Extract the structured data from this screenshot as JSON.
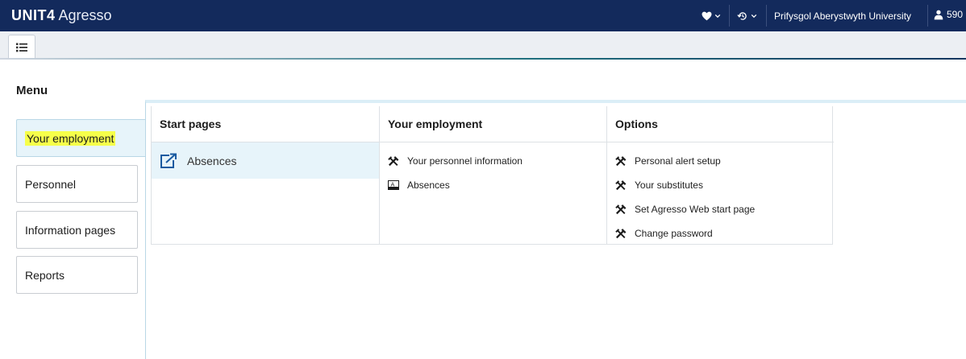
{
  "app": {
    "brand_bold": "UNIT4",
    "brand_light": "Agresso",
    "university": "Prifysgol Aberystwyth University",
    "user_id": "590"
  },
  "menu": {
    "title": "Menu",
    "tabs": [
      {
        "label": "Your employment",
        "active": true
      },
      {
        "label": "Personnel",
        "active": false
      },
      {
        "label": "Information pages",
        "active": false
      },
      {
        "label": "Reports",
        "active": false
      }
    ]
  },
  "columns": {
    "start_pages": {
      "header": "Start pages",
      "items": [
        {
          "label": "Absences",
          "icon": "external-link-icon"
        }
      ]
    },
    "your_employment": {
      "header": "Your employment",
      "items": [
        {
          "label": "Your personnel information",
          "icon": "tools-icon"
        },
        {
          "label": "Absences",
          "icon": "form-icon"
        }
      ]
    },
    "options": {
      "header": "Options",
      "items": [
        {
          "label": "Personal alert setup",
          "icon": "tools-icon"
        },
        {
          "label": "Your substitutes",
          "icon": "tools-icon"
        },
        {
          "label": "Set Agresso Web start page",
          "icon": "tools-icon"
        },
        {
          "label": "Change password",
          "icon": "tools-icon"
        }
      ]
    }
  },
  "colors": {
    "topbar": "#132a5c",
    "active_tab_bg": "#e7f4fa",
    "highlight": "#f6ff4a",
    "icon_blue": "#1a5aa0"
  }
}
